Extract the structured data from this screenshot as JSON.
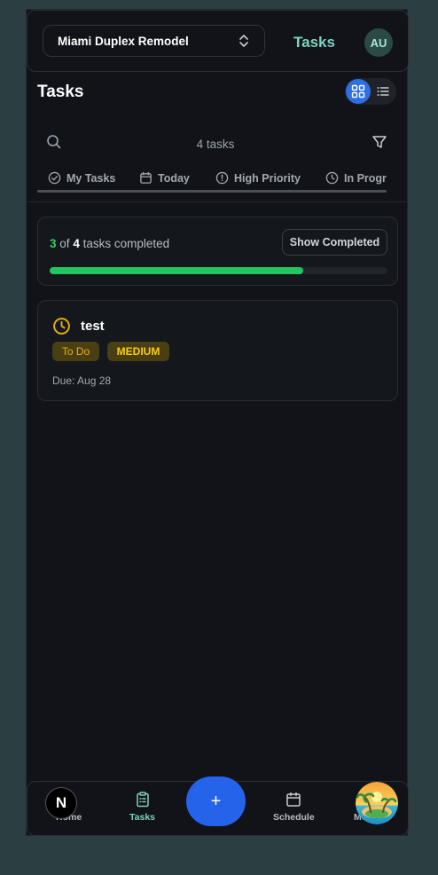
{
  "header": {
    "project_name": "Miami Duplex Remodel",
    "app_title": "Tasks",
    "avatar_initials": "AU"
  },
  "page": {
    "title": "Tasks"
  },
  "search": {
    "count_text": "4 tasks"
  },
  "filter_tabs": [
    "My Tasks",
    "Today",
    "High Priority",
    "In Progress"
  ],
  "progress": {
    "completed": "3",
    "of_word": "of",
    "total": "4",
    "suffix": "tasks completed",
    "button_label": "Show Completed",
    "fraction": 0.75
  },
  "tasks": [
    {
      "title": "test",
      "status": "To Do",
      "priority": "MEDIUM",
      "due": "Due: Aug 28"
    }
  ],
  "bottom_nav": {
    "items": [
      "Home",
      "Tasks",
      "Schedule",
      "More"
    ],
    "fab_label": "+",
    "dev_badge": "N"
  },
  "colors": {
    "accent_teal": "#7dd3c0",
    "primary_blue": "#2563eb",
    "progress_green": "#22c55e",
    "badge_yellow": "#eab308"
  }
}
